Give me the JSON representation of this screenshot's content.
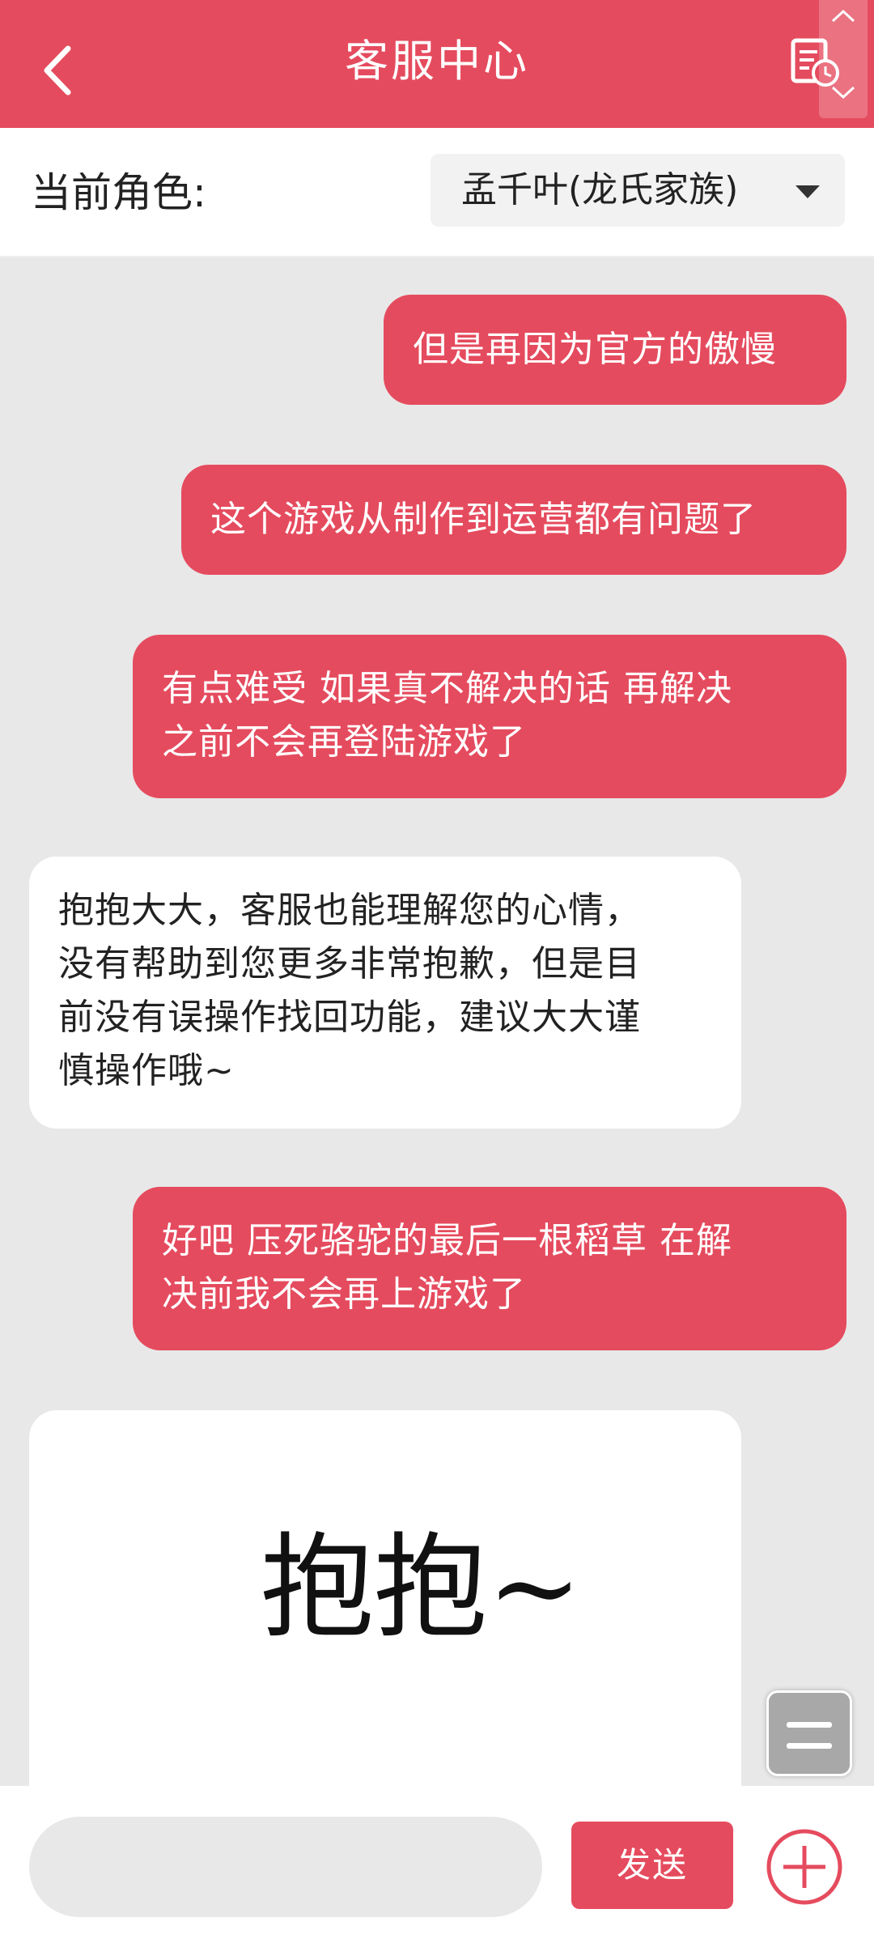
{
  "header": {
    "title": "客服中心",
    "back_icon": "chevron-left-icon",
    "history_icon": "chat-history-icon"
  },
  "role": {
    "label": "当前角色:",
    "selected": "孟千叶(龙氏家族)"
  },
  "messages": [
    {
      "sender": "user",
      "text": "但是再因为官方的傲慢"
    },
    {
      "sender": "user",
      "text": "这个游戏从制作到运营都有问题了"
    },
    {
      "sender": "user",
      "text": "有点难受 如果真不解决的话 再解决\n之前不会再登陆游戏了"
    },
    {
      "sender": "agent",
      "text": "抱抱大大，客服也能理解您的心情，\n没有帮助到您更多非常抱歉，但是目\n前没有误操作找回功能，建议大大谨\n慎操作哦~"
    },
    {
      "sender": "user",
      "text": "好吧 压死骆驼的最后一根稻草 在解\n决前我不会再上游戏了"
    },
    {
      "sender": "agent",
      "type": "sticker",
      "text": "抱抱~"
    }
  ],
  "input": {
    "placeholder": "",
    "send_label": "发送"
  },
  "colors": {
    "accent": "#e54b5e",
    "chat_bg": "#e8e8e8"
  }
}
